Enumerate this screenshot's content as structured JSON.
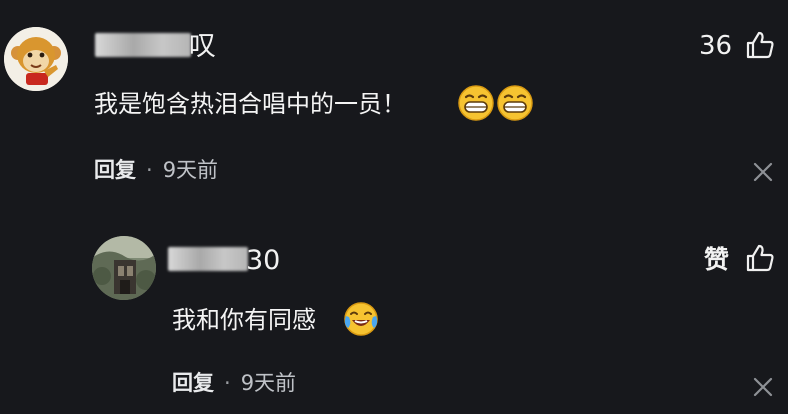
{
  "comment": {
    "username_suffix": "叹",
    "like_count": "36",
    "text": "我是饱含热泪合唱中的一员！",
    "reply_label": "回复",
    "separator": "·",
    "time": "9天前"
  },
  "reply": {
    "username_suffix": "30",
    "like_label": "赞",
    "text": "我和你有同感",
    "reply_label": "回复",
    "separator": "·",
    "time": "9天前"
  },
  "icons": [
    "monkey-avatar",
    "thumbs-up-icon",
    "grin-emoji",
    "close-icon",
    "photo-avatar",
    "crying-laugh-emoji"
  ],
  "colors": {
    "background": "#17181c",
    "text": "#f2f2f2",
    "meta": "#bfc2c7"
  }
}
